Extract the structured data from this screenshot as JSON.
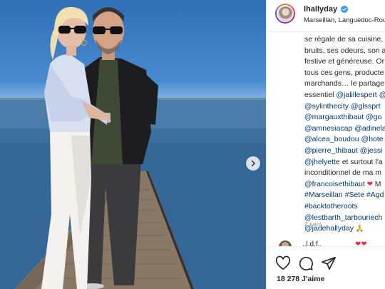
{
  "post": {
    "username": "lhallyday",
    "location": "Marseillan, Languedoc-Rous",
    "caption_lines": [
      {
        "t": "se régale de sa cuisine,"
      },
      {
        "t": "bruits, ses odeurs, son a"
      },
      {
        "t": "festive et généreuse. Or"
      },
      {
        "t": "tous ces gens, producte"
      },
      {
        "t": "marchands… le partage"
      },
      {
        "t": "essentiel ",
        "link": "@jalillespert @"
      },
      {
        "link": "@sylinthecity @glssprt"
      },
      {
        "link": "@margauxthibaut @go"
      },
      {
        "link": "@amnesiacap @adinela"
      },
      {
        "link": "@alcea_boudou @hote"
      },
      {
        "link": "@pierre_thibaut @jessi"
      },
      {
        "t": "",
        "link": "@jhelyette",
        "after": " et surtout l'a"
      },
      {
        "t": "inconditionnel de ma m"
      },
      {
        "link": "@francoisethibaut",
        "emoji": " ❤ ",
        "after": "M"
      },
      {
        "link": "#Marseillan #Sete #Agd"
      },
      {
        "link": "#backtotheroots"
      },
      {
        "link": "@lestbarth_tarbouriech"
      },
      {
        "link": "@jadehallyday",
        "emoji2": " 🙏"
      }
    ],
    "time": "2 sem",
    "likes_count": "18 278",
    "likes_label": "J'aime"
  },
  "comment_peek": {
    "text": "..l.d.f..",
    "hearts": "❤❤"
  },
  "icons": {
    "verified": "verified-badge-icon",
    "like": "heart-outline-icon",
    "comment": "comment-bubble-icon",
    "share": "paper-plane-icon",
    "next": "chevron-right-icon"
  },
  "colors": {
    "link": "#00376b",
    "text": "#262626",
    "muted": "#8e8e8e",
    "verified": "#3897f0",
    "heart": "#ed2b3e"
  }
}
